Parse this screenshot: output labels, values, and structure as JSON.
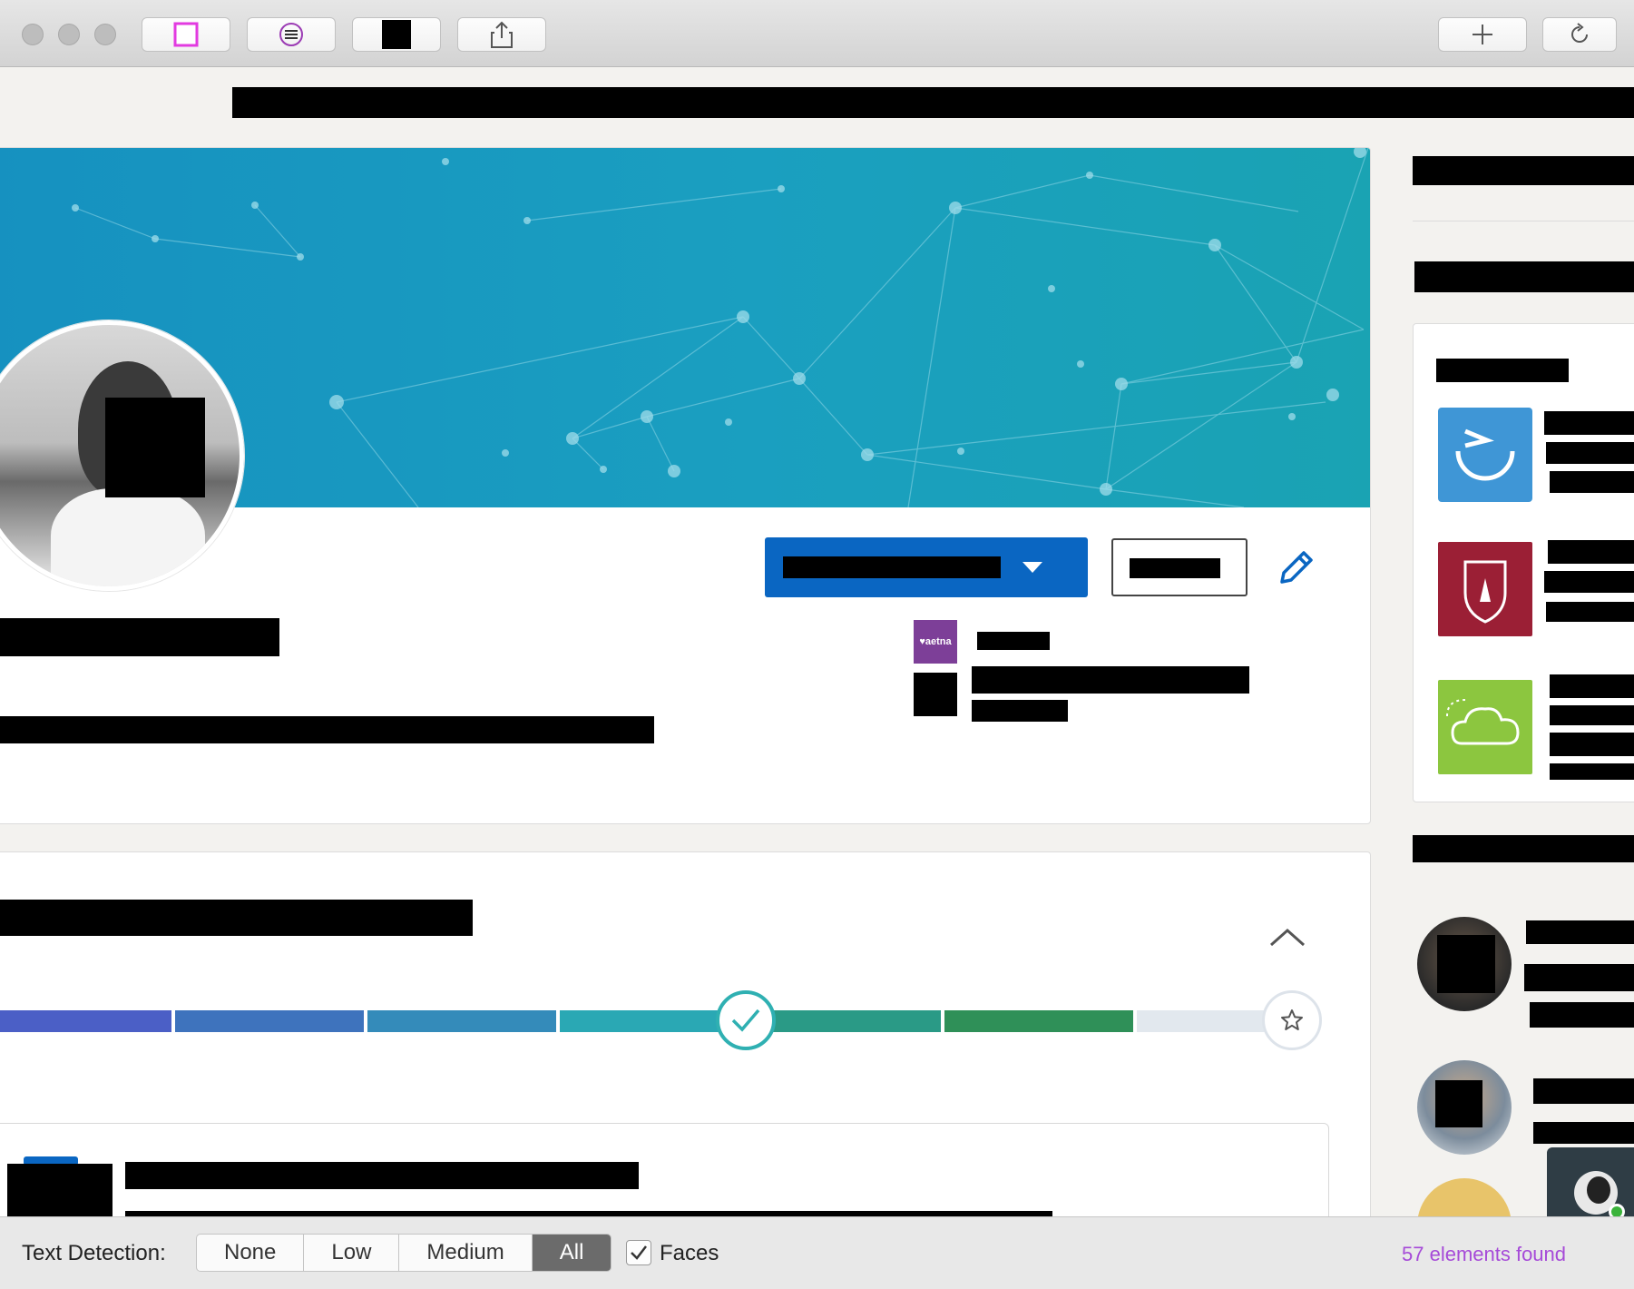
{
  "window": {
    "toolbar_buttons": [
      "select-box-icon",
      "text-lines-icon",
      "black-square-icon",
      "share-icon"
    ],
    "right_buttons": [
      "plus-icon",
      "reload-icon"
    ]
  },
  "profile": {
    "company_logo_text": "♥aetna"
  },
  "bottom_bar": {
    "label": "Text Detection:",
    "options": [
      "None",
      "Low",
      "Medium",
      "All"
    ],
    "selected": "All",
    "faces_label": "Faces",
    "faces_checked": true,
    "found_text": "57 elements found",
    "found_color": "#a64ad8"
  },
  "colors": {
    "accent": "#0a66c2",
    "banner": "#1a9fc0",
    "progress_check": "#2fb0b2"
  }
}
